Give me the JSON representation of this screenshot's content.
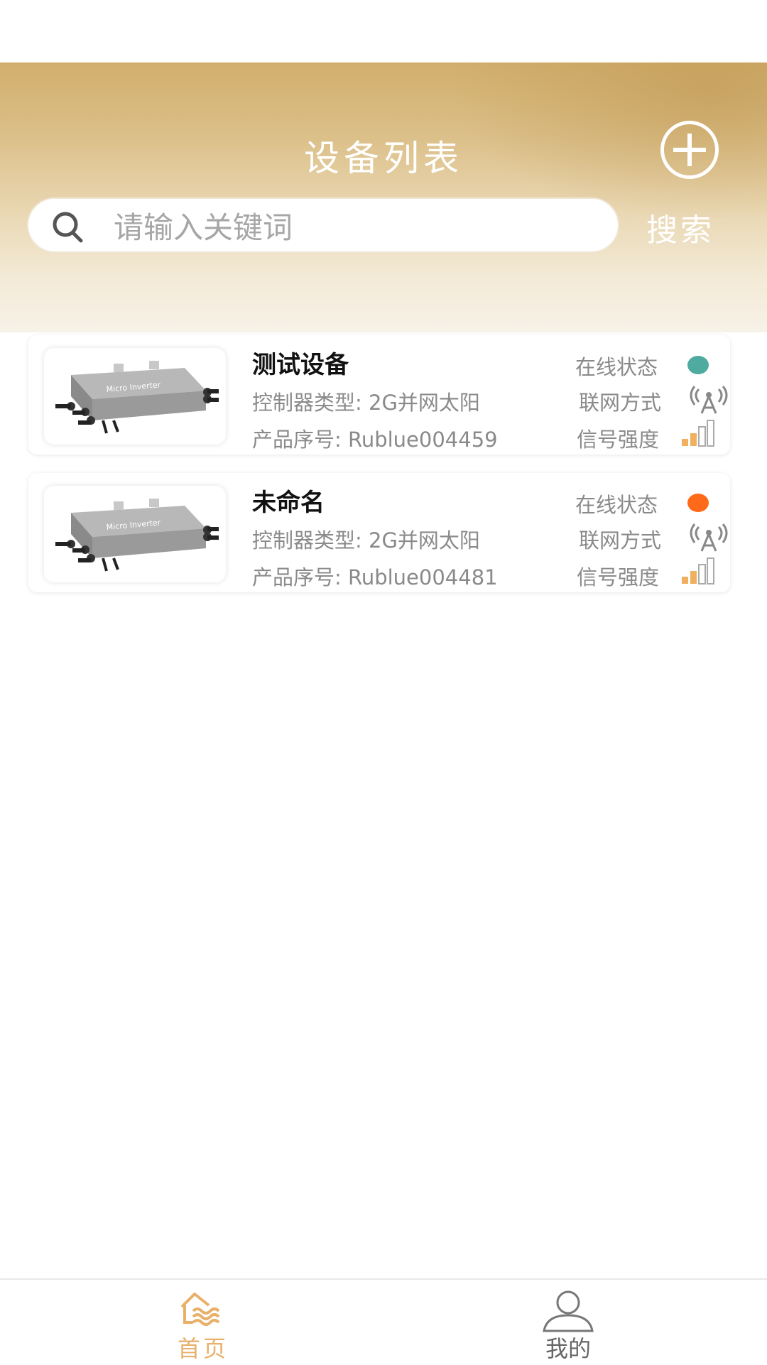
{
  "header": {
    "title": "设备列表",
    "search_placeholder": "请输入关键词",
    "search_button": "搜索"
  },
  "devices": [
    {
      "name": "测试设备",
      "controller_type": "控制器类型: 2G并网太阳",
      "serial": "产品序号: Rublue004459",
      "online_label": "在线状态",
      "online_color": "#4faaa0",
      "network_label": "联网方式",
      "signal_label": "信号强度",
      "signal_level": 2,
      "signal_max": 4
    },
    {
      "name": "未命名",
      "controller_type": "控制器类型: 2G并网太阳",
      "serial": "产品序号: Rublue004481",
      "online_label": "在线状态",
      "online_color": "#ff6a1a",
      "network_label": "联网方式",
      "signal_label": "信号强度",
      "signal_level": 2,
      "signal_max": 4
    }
  ],
  "tabbar": {
    "home_label": "首页",
    "mine_label": "我的",
    "active": "home",
    "active_color": "#e8b068"
  }
}
